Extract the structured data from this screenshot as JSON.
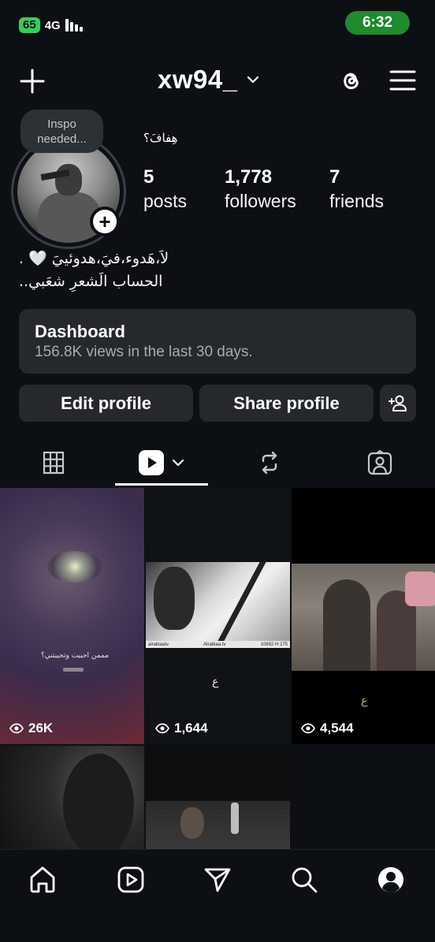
{
  "status_bar": {
    "battery": "65",
    "network": "4G",
    "time": "6:32"
  },
  "header": {
    "username": "xw94_"
  },
  "profile": {
    "note": [
      "Inspo",
      "needed..."
    ],
    "display_name": "هِفافَ؟",
    "stats": [
      {
        "value": "5",
        "label": "posts"
      },
      {
        "value": "1,778",
        "label": "followers"
      },
      {
        "value": "7",
        "label": "friends"
      }
    ],
    "bio_lines": [
      "لاَ،هَدوء،فيَ،هدوئييَ 🤍 .",
      "الحساب الَشعرِ شعَبي.."
    ]
  },
  "dashboard": {
    "title": "Dashboard",
    "subtitle": "156.8K views in the last 30 days."
  },
  "buttons": {
    "edit_profile": "Edit profile",
    "share_profile": "Share profile"
  },
  "tabs": [
    "grid",
    "reels",
    "reposts",
    "tagged"
  ],
  "active_tab": "reels",
  "posts": [
    {
      "views": "26K",
      "caption": "مممن احببت وتحببتني؟"
    },
    {
      "views": "1,644",
      "caption": "ع",
      "ticker_left": "alrabiaatv",
      "ticker_mid": "Alrabiaa.tv",
      "ticker_right": "10892  H  275"
    },
    {
      "views": "4,544",
      "caption": "ع"
    },
    {
      "views": ""
    },
    {
      "views": ""
    }
  ],
  "colors": {
    "background": "#0c1014",
    "surface": "#25292e",
    "status_green": "#1f8a2e",
    "battery_green": "#2fd158"
  }
}
